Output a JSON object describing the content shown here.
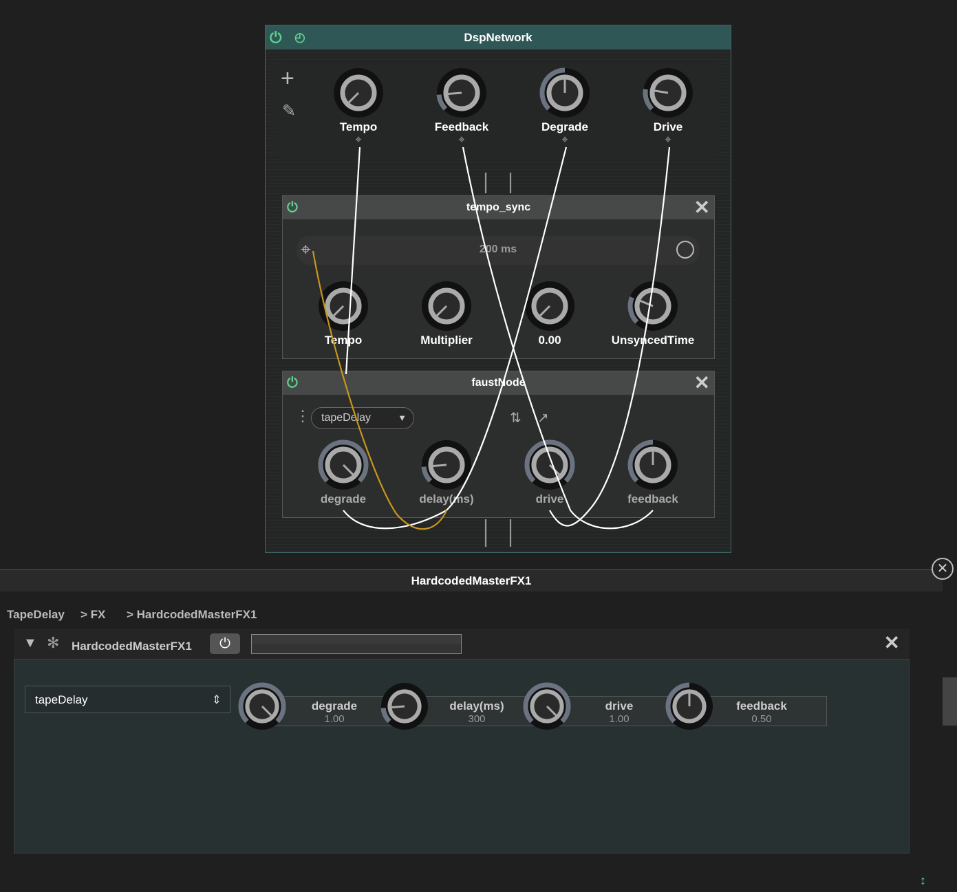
{
  "network": {
    "title": "DspNetwork",
    "macros": [
      {
        "label": "Tempo",
        "value": 0.0
      },
      {
        "label": "Feedback",
        "value": 0.15
      },
      {
        "label": "Degrade",
        "value": 0.5
      },
      {
        "label": "Drive",
        "value": 0.2
      }
    ]
  },
  "tempo_sync": {
    "title": "tempo_sync",
    "display": "200 ms",
    "knobs": [
      {
        "label": "Tempo",
        "value": 0.0
      },
      {
        "label": "Multiplier",
        "value": 0.0
      },
      {
        "label": "0.00",
        "value": 0.0
      },
      {
        "label": "UnsyncedTime",
        "value": 0.25
      }
    ]
  },
  "faust": {
    "title": "faustNode",
    "selected": "tapeDelay",
    "knobs": [
      {
        "label": "degrade",
        "value": 1.0
      },
      {
        "label": "delay(ms)",
        "value": 0.15
      },
      {
        "label": "drive",
        "value": 1.0
      },
      {
        "label": "feedback",
        "value": 0.5
      }
    ]
  },
  "panel": {
    "title": "HardcodedMasterFX1",
    "breadcrumb": [
      "TapeDelay",
      "> FX",
      "> HardcodedMasterFX1"
    ],
    "module_name": "HardcodedMasterFX1",
    "selector": "tapeDelay",
    "params": [
      {
        "name": "degrade",
        "value": "1.00",
        "fill": 1.0
      },
      {
        "name": "delay(ms)",
        "value": "300",
        "fill": 0.15
      },
      {
        "name": "drive",
        "value": "1.00",
        "fill": 1.0
      },
      {
        "name": "feedback",
        "value": "0.50",
        "fill": 0.5
      }
    ]
  },
  "colors": {
    "accent": "#5fcf8f",
    "header": "#2f5755",
    "cable": "#ffffff",
    "modcable": "#c8961e"
  }
}
